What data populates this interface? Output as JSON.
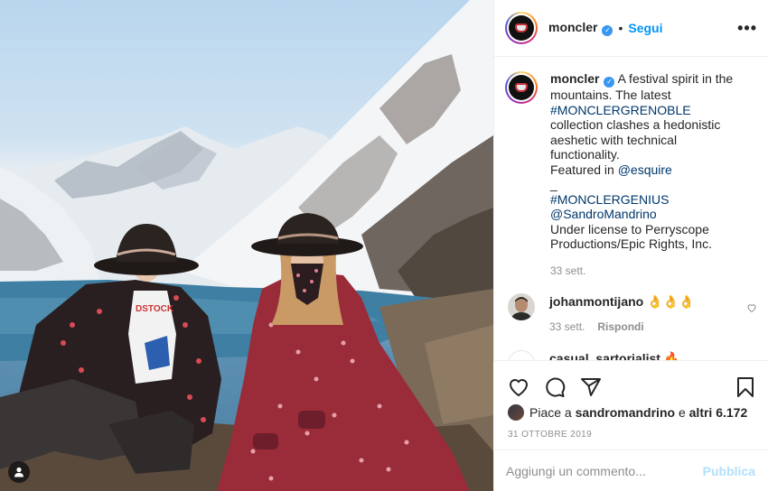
{
  "post": {
    "username": "moncler",
    "follow_label": "Segui",
    "separator": "•",
    "more_label": "•••"
  },
  "caption": {
    "username": "moncler",
    "line1": "A festival spirit in the mountains. The latest",
    "hashtag1": "#MONCLERGRENOBLE",
    "line2": "collection clashes a hedonistic aeshetic with technical functionality.",
    "featured_prefix": "Featured in",
    "mention1": "@esquire",
    "underscore": "_",
    "hashtag2": "#MONCLERGENIUS",
    "mention2": "@SandroMandrino",
    "license": "Under license to Perryscope Productions/Epic Rights, Inc.",
    "time": "33 sett."
  },
  "comments": [
    {
      "username": "johanmontijano",
      "text": "👌👌👌",
      "time": "33 sett.",
      "reply_label": "Rispondi"
    },
    {
      "username": "casual_sartorialist",
      "text": "🔥"
    }
  ],
  "likes": {
    "prefix": "Piace a",
    "user": "sandromandrino",
    "joiner": "e",
    "others": "altri 6.172"
  },
  "date": "31 OTTOBRE 2019",
  "comment_box": {
    "placeholder": "Aggiungi un commento...",
    "publish_label": "Pubblica"
  },
  "colors": {
    "link": "#00376b",
    "follow": "#0095f6",
    "muted": "#8e8e8e",
    "publish_disabled": "#b2dffc"
  },
  "icons": [
    "user-tag-icon",
    "verified-badge-icon",
    "more-options-icon",
    "heart-icon",
    "comment-icon",
    "share-icon",
    "bookmark-icon"
  ]
}
